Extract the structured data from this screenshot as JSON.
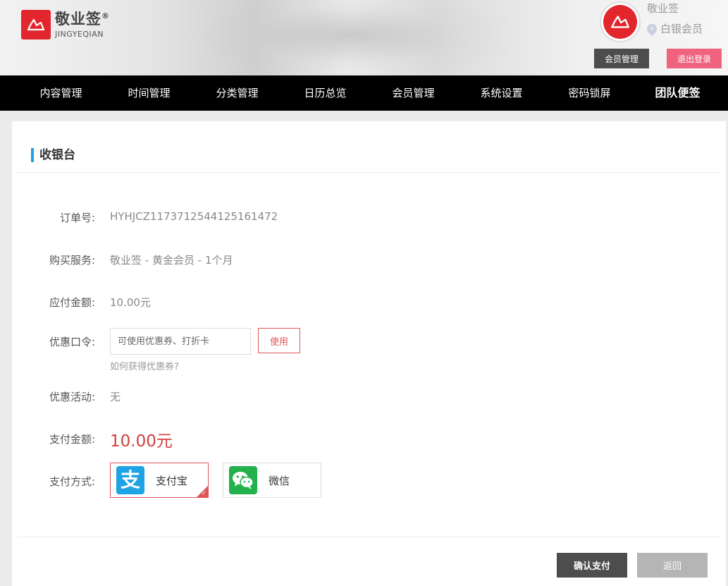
{
  "header": {
    "logo_cn": "敬业签",
    "logo_reg": "®",
    "logo_en": "JINGYEQIAN",
    "user_name": "敬业签",
    "user_level": "白银会员",
    "level_icon_glyph": "v",
    "member_manage_label": "会员管理",
    "logout_label": "退出登录"
  },
  "nav": {
    "items": [
      "内容管理",
      "时间管理",
      "分类管理",
      "日历总览",
      "会员管理",
      "系统设置",
      "密码锁屏",
      "团队便签"
    ]
  },
  "checkout": {
    "title": "收银台",
    "order_label": "订单号:",
    "order_value": "HYHJCZ1173712544125161472",
    "service_label": "购买服务:",
    "service_value": "敬业签 - 黄金会员 - 1个月",
    "amount_due_label": "应付金额:",
    "amount_due_value": "10.00元",
    "coupon_label": "优惠口令:",
    "coupon_placeholder": "可使用优惠券、打折卡",
    "coupon_use_label": "使用",
    "coupon_help": "如何获得优惠券?",
    "promo_label": "优惠活动:",
    "promo_value": "无",
    "pay_amount_label": "支付金额:",
    "pay_amount_value": "10.00元",
    "pay_method_label": "支付方式:",
    "pay_methods": [
      {
        "label": "支付宝",
        "icon": "alipay-icon",
        "color": "#1ea3e4",
        "glyph": "支",
        "selected": true
      },
      {
        "label": "微信",
        "icon": "wechat-icon",
        "color": "#22b14c",
        "selected": false
      }
    ]
  },
  "actions": {
    "confirm_label": "确认支付",
    "back_label": "返回"
  },
  "colors": {
    "brand_red": "#e3262e",
    "accent_blue": "#1ea3e4",
    "price_red": "#d23f3f",
    "logout_pink": "#f0637f"
  }
}
